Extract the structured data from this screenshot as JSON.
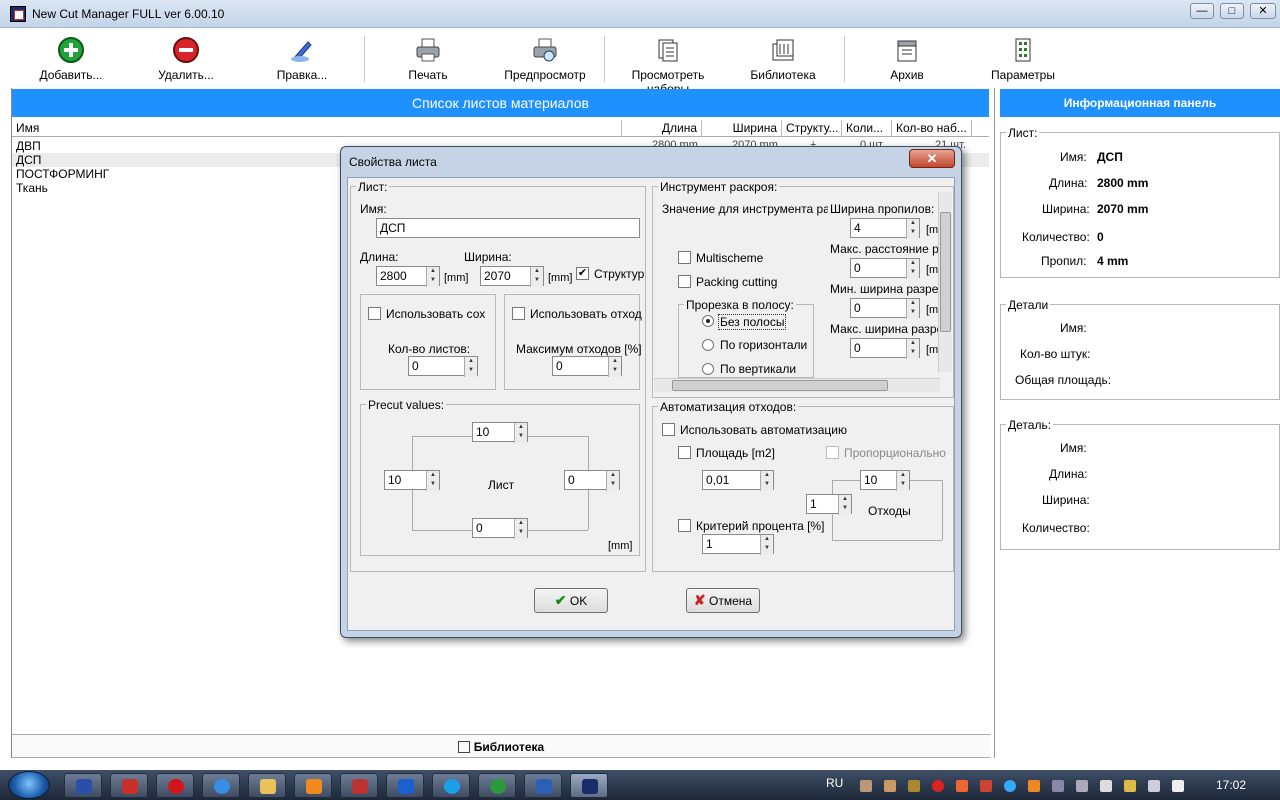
{
  "window": {
    "title": "New Cut Manager FULL ver 6.00.10",
    "min": "—",
    "max": "□",
    "close": "✕"
  },
  "toolbar": [
    {
      "id": "add",
      "label": "Добавить...",
      "icon": "add-icon"
    },
    {
      "id": "delete",
      "label": "Удалить...",
      "icon": "delete-icon"
    },
    {
      "id": "edit",
      "label": "Правка...",
      "icon": "edit-icon"
    },
    {
      "id": "print",
      "label": "Печать",
      "icon": "printer-icon"
    },
    {
      "id": "preview",
      "label": "Предпросмотр",
      "icon": "print-preview-icon"
    },
    {
      "id": "sets",
      "label": "Просмотреть наборы",
      "icon": "sets-icon"
    },
    {
      "id": "library",
      "label": "Библиотека",
      "icon": "library-icon"
    },
    {
      "id": "archive",
      "label": "Архив",
      "icon": "archive-icon"
    },
    {
      "id": "params",
      "label": "Параметры",
      "icon": "settings-icon"
    }
  ],
  "list": {
    "title": "Список листов материалов",
    "columns": [
      "Имя",
      "Длина",
      "Ширина",
      "Структу...",
      "Коли...",
      "Кол-во наб..."
    ],
    "rows": [
      {
        "name": "ДВП",
        "length": "2800 mm",
        "width": "2070 mm",
        "struct": "+",
        "qty": "0 шт.",
        "sets": "21 шт."
      },
      {
        "name": "ДСП",
        "length": "",
        "width": "",
        "struct": "",
        "qty": "",
        "sets": ""
      },
      {
        "name": "ПОСТФОРМИНГ",
        "length": "",
        "width": "",
        "struct": "",
        "qty": "",
        "sets": ""
      },
      {
        "name": "Ткань",
        "length": "",
        "width": "",
        "struct": "",
        "qty": "",
        "sets": ""
      }
    ],
    "bottom_tab": "Библиотека"
  },
  "info": {
    "title": "Информационная панель",
    "sheet": {
      "group": "Лист:",
      "name_label": "Имя:",
      "name": "ДСП",
      "length_label": "Длина:",
      "length": "2800 mm",
      "width_label": "Ширина:",
      "width": "2070 mm",
      "qty_label": "Количество:",
      "qty": "0",
      "kerf_label": "Пропил:",
      "kerf": "4 mm"
    },
    "details": {
      "group": "Детали",
      "name_label": "Имя:",
      "count_label": "Кол-во штук:",
      "area_label": "Общая площадь:"
    },
    "detail": {
      "group": "Деталь:",
      "name_label": "Имя:",
      "length_label": "Длина:",
      "width_label": "Ширина:",
      "qty_label": "Количество:"
    }
  },
  "dialog": {
    "title": "Свойства листа",
    "close": "✕",
    "sheet_group": "Лист:",
    "name_label": "Имя:",
    "name_value": "ДСП",
    "length_label": "Длина:",
    "length_value": "2800",
    "width_label": "Ширина:",
    "width_value": "2070",
    "mm": "[mm]",
    "structure_label": "Структур",
    "structure_checked": true,
    "use_stock_label": "Использовать сох",
    "sheet_count_label": "Кол-во листов:",
    "sheet_count_value": "0",
    "use_waste_label": "Использовать отход",
    "max_waste_label": "Максимум отходов [%]",
    "max_waste_value": "0",
    "precut_group": "Precut values:",
    "precut_top": "10",
    "precut_left": "10",
    "precut_right": "0",
    "precut_bottom": "0",
    "precut_center": "Лист",
    "precut_mm": "[mm]",
    "tool_group": "Инструмент раскроя:",
    "tool_value_label": "Значение для инструмента раскр",
    "kerf_label": "Ширина пропилов:",
    "kerf_value": "4",
    "unit_short": "[m",
    "multischeme_label": "Multischeme",
    "packing_label": "Packing cutting",
    "max_dist_label": "Макс. расстояние ра",
    "max_dist_value": "0",
    "strip_group": "Прорезка в полосу:",
    "strip_none": "Без полосы",
    "strip_horiz": "По горизонтали",
    "strip_vert": "По вертикали",
    "min_cut_label": "Мин. ширина разрез",
    "min_cut_value": "0",
    "max_cut_label": "Макс. ширина разрез",
    "max_cut_value": "0",
    "auto_group": "Автоматизация отходов:",
    "use_auto_label": "Использовать автоматизацию",
    "area_label": "Площадь [m2]",
    "area_value": "0,01",
    "proportional_label": "Пропорционально",
    "waste_top": "10",
    "waste_left": "1",
    "waste_label": "Отходы",
    "percent_label": "Критерий процента [%]",
    "percent_value": "1",
    "ok": "OK",
    "cancel": "Отмена"
  },
  "taskbar": {
    "lang": "RU",
    "clock": "17:02"
  }
}
